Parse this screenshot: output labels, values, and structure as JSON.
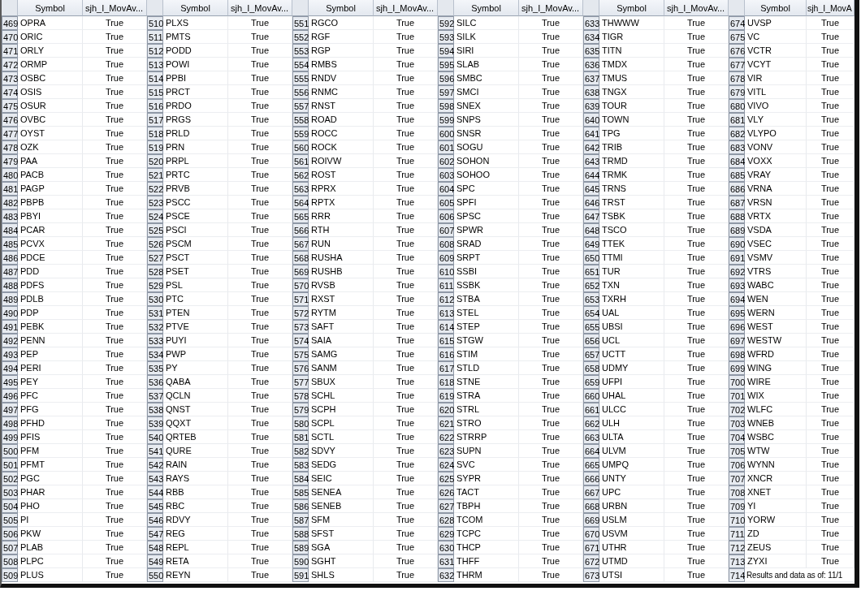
{
  "panels": [
    {
      "columns": [
        "Symbol",
        "sjh_I_MovAv..."
      ],
      "rows": [
        {
          "kind": "data",
          "n": "469",
          "symbol": "OPRA",
          "value": "True"
        },
        {
          "kind": "data",
          "n": "470",
          "symbol": "ORIC",
          "value": "True"
        },
        {
          "kind": "data",
          "n": "471",
          "symbol": "ORLY",
          "value": "True"
        },
        {
          "kind": "data",
          "n": "472",
          "symbol": "ORMP",
          "value": "True"
        },
        {
          "kind": "data",
          "n": "473",
          "symbol": "OSBC",
          "value": "True"
        },
        {
          "kind": "data",
          "n": "474",
          "symbol": "OSIS",
          "value": "True"
        },
        {
          "kind": "data",
          "n": "475",
          "symbol": "OSUR",
          "value": "True"
        },
        {
          "kind": "data",
          "n": "476",
          "symbol": "OVBC",
          "value": "True"
        },
        {
          "kind": "data",
          "n": "477",
          "symbol": "OYST",
          "value": "True"
        },
        {
          "kind": "data",
          "n": "478",
          "symbol": "OZK",
          "value": "True"
        },
        {
          "kind": "data",
          "n": "479",
          "symbol": "PAA",
          "value": "True"
        },
        {
          "kind": "data",
          "n": "480",
          "symbol": "PACB",
          "value": "True"
        },
        {
          "kind": "data",
          "n": "481",
          "symbol": "PAGP",
          "value": "True"
        },
        {
          "kind": "data",
          "n": "482",
          "symbol": "PBPB",
          "value": "True"
        },
        {
          "kind": "data",
          "n": "483",
          "symbol": "PBYI",
          "value": "True"
        },
        {
          "kind": "data",
          "n": "484",
          "symbol": "PCAR",
          "value": "True"
        },
        {
          "kind": "data",
          "n": "485",
          "symbol": "PCVX",
          "value": "True"
        },
        {
          "kind": "data",
          "n": "486",
          "symbol": "PDCE",
          "value": "True"
        },
        {
          "kind": "data",
          "n": "487",
          "symbol": "PDD",
          "value": "True"
        },
        {
          "kind": "data",
          "n": "488",
          "symbol": "PDFS",
          "value": "True"
        },
        {
          "kind": "data",
          "n": "489",
          "symbol": "PDLB",
          "value": "True"
        },
        {
          "kind": "data",
          "n": "490",
          "symbol": "PDP",
          "value": "True"
        },
        {
          "kind": "data",
          "n": "491",
          "symbol": "PEBK",
          "value": "True"
        },
        {
          "kind": "data",
          "n": "492",
          "symbol": "PENN",
          "value": "True"
        },
        {
          "kind": "data",
          "n": "493",
          "symbol": "PEP",
          "value": "True"
        },
        {
          "kind": "data",
          "n": "494",
          "symbol": "PERI",
          "value": "True"
        },
        {
          "kind": "data",
          "n": "495",
          "symbol": "PEY",
          "value": "True"
        },
        {
          "kind": "data",
          "n": "496",
          "symbol": "PFC",
          "value": "True"
        },
        {
          "kind": "data",
          "n": "497",
          "symbol": "PFG",
          "value": "True"
        },
        {
          "kind": "data",
          "n": "498",
          "symbol": "PFHD",
          "value": "True"
        },
        {
          "kind": "data",
          "n": "499",
          "symbol": "PFIS",
          "value": "True"
        },
        {
          "kind": "data",
          "n": "500",
          "symbol": "PFM",
          "value": "True"
        },
        {
          "kind": "data",
          "n": "501",
          "symbol": "PFMT",
          "value": "True"
        },
        {
          "kind": "data",
          "n": "502",
          "symbol": "PGC",
          "value": "True"
        },
        {
          "kind": "data",
          "n": "503",
          "symbol": "PHAR",
          "value": "True"
        },
        {
          "kind": "data",
          "n": "504",
          "symbol": "PHO",
          "value": "True"
        },
        {
          "kind": "data",
          "n": "505",
          "symbol": "PI",
          "value": "True"
        },
        {
          "kind": "data",
          "n": "506",
          "symbol": "PKW",
          "value": "True"
        },
        {
          "kind": "data",
          "n": "507",
          "symbol": "PLAB",
          "value": "True"
        },
        {
          "kind": "data",
          "n": "508",
          "symbol": "PLPC",
          "value": "True"
        },
        {
          "kind": "data",
          "n": "509",
          "symbol": "PLUS",
          "value": "True"
        }
      ]
    },
    {
      "columns": [
        "Symbol",
        "sjh_I_MovAv..."
      ],
      "rows": [
        {
          "kind": "data",
          "n": "510",
          "symbol": "PLXS",
          "value": "True"
        },
        {
          "kind": "data",
          "n": "511",
          "symbol": "PMTS",
          "value": "True"
        },
        {
          "kind": "data",
          "n": "512",
          "symbol": "PODD",
          "value": "True"
        },
        {
          "kind": "data",
          "n": "513",
          "symbol": "POWI",
          "value": "True"
        },
        {
          "kind": "data",
          "n": "514",
          "symbol": "PPBI",
          "value": "True"
        },
        {
          "kind": "data",
          "n": "515",
          "symbol": "PRCT",
          "value": "True"
        },
        {
          "kind": "data",
          "n": "516",
          "symbol": "PRDO",
          "value": "True"
        },
        {
          "kind": "data",
          "n": "517",
          "symbol": "PRGS",
          "value": "True"
        },
        {
          "kind": "data",
          "n": "518",
          "symbol": "PRLD",
          "value": "True"
        },
        {
          "kind": "data",
          "n": "519",
          "symbol": "PRN",
          "value": "True"
        },
        {
          "kind": "data",
          "n": "520",
          "symbol": "PRPL",
          "value": "True"
        },
        {
          "kind": "data",
          "n": "521",
          "symbol": "PRTC",
          "value": "True"
        },
        {
          "kind": "data",
          "n": "522",
          "symbol": "PRVB",
          "value": "True"
        },
        {
          "kind": "data",
          "n": "523",
          "symbol": "PSCC",
          "value": "True"
        },
        {
          "kind": "data",
          "n": "524",
          "symbol": "PSCE",
          "value": "True"
        },
        {
          "kind": "data",
          "n": "525",
          "symbol": "PSCI",
          "value": "True"
        },
        {
          "kind": "data",
          "n": "526",
          "symbol": "PSCM",
          "value": "True"
        },
        {
          "kind": "data",
          "n": "527",
          "symbol": "PSCT",
          "value": "True"
        },
        {
          "kind": "data",
          "n": "528",
          "symbol": "PSET",
          "value": "True"
        },
        {
          "kind": "data",
          "n": "529",
          "symbol": "PSL",
          "value": "True"
        },
        {
          "kind": "data",
          "n": "530",
          "symbol": "PTC",
          "value": "True"
        },
        {
          "kind": "data",
          "n": "531",
          "symbol": "PTEN",
          "value": "True"
        },
        {
          "kind": "data",
          "n": "532",
          "symbol": "PTVE",
          "value": "True"
        },
        {
          "kind": "data",
          "n": "533",
          "symbol": "PUYI",
          "value": "True"
        },
        {
          "kind": "data",
          "n": "534",
          "symbol": "PWP",
          "value": "True"
        },
        {
          "kind": "data",
          "n": "535",
          "symbol": "PY",
          "value": "True"
        },
        {
          "kind": "data",
          "n": "536",
          "symbol": "QABA",
          "value": "True"
        },
        {
          "kind": "data",
          "n": "537",
          "symbol": "QCLN",
          "value": "True"
        },
        {
          "kind": "data",
          "n": "538",
          "symbol": "QNST",
          "value": "True"
        },
        {
          "kind": "data",
          "n": "539",
          "symbol": "QQXT",
          "value": "True"
        },
        {
          "kind": "data",
          "n": "540",
          "symbol": "QRTEB",
          "value": "True"
        },
        {
          "kind": "data",
          "n": "541",
          "symbol": "QURE",
          "value": "True"
        },
        {
          "kind": "data",
          "n": "542",
          "symbol": "RAIN",
          "value": "True"
        },
        {
          "kind": "data",
          "n": "543",
          "symbol": "RAYS",
          "value": "True"
        },
        {
          "kind": "data",
          "n": "544",
          "symbol": "RBB",
          "value": "True"
        },
        {
          "kind": "data",
          "n": "545",
          "symbol": "RBC",
          "value": "True"
        },
        {
          "kind": "data",
          "n": "546",
          "symbol": "RDVY",
          "value": "True"
        },
        {
          "kind": "data",
          "n": "547",
          "symbol": "REG",
          "value": "True"
        },
        {
          "kind": "data",
          "n": "548",
          "symbol": "REPL",
          "value": "True"
        },
        {
          "kind": "data",
          "n": "549",
          "symbol": "RETA",
          "value": "True"
        },
        {
          "kind": "data",
          "n": "550",
          "symbol": "REYN",
          "value": "True"
        }
      ]
    },
    {
      "columns": [
        "Symbol",
        "sjh_I_MovAv..."
      ],
      "rows": [
        {
          "kind": "data",
          "n": "551",
          "symbol": "RGCO",
          "value": "True"
        },
        {
          "kind": "data",
          "n": "552",
          "symbol": "RGF",
          "value": "True"
        },
        {
          "kind": "data",
          "n": "553",
          "symbol": "RGP",
          "value": "True"
        },
        {
          "kind": "data",
          "n": "554",
          "symbol": "RMBS",
          "value": "True"
        },
        {
          "kind": "data",
          "n": "555",
          "symbol": "RNDV",
          "value": "True"
        },
        {
          "kind": "data",
          "n": "556",
          "symbol": "RNMC",
          "value": "True"
        },
        {
          "kind": "data",
          "n": "557",
          "symbol": "RNST",
          "value": "True"
        },
        {
          "kind": "data",
          "n": "558",
          "symbol": "ROAD",
          "value": "True"
        },
        {
          "kind": "data",
          "n": "559",
          "symbol": "ROCC",
          "value": "True"
        },
        {
          "kind": "data",
          "n": "560",
          "symbol": "ROCK",
          "value": "True"
        },
        {
          "kind": "data",
          "n": "561",
          "symbol": "ROIVW",
          "value": "True"
        },
        {
          "kind": "data",
          "n": "562",
          "symbol": "ROST",
          "value": "True"
        },
        {
          "kind": "data",
          "n": "563",
          "symbol": "RPRX",
          "value": "True"
        },
        {
          "kind": "data",
          "n": "564",
          "symbol": "RPTX",
          "value": "True"
        },
        {
          "kind": "data",
          "n": "565",
          "symbol": "RRR",
          "value": "True"
        },
        {
          "kind": "data",
          "n": "566",
          "symbol": "RTH",
          "value": "True"
        },
        {
          "kind": "data",
          "n": "567",
          "symbol": "RUN",
          "value": "True"
        },
        {
          "kind": "data",
          "n": "568",
          "symbol": "RUSHA",
          "value": "True"
        },
        {
          "kind": "data",
          "n": "569",
          "symbol": "RUSHB",
          "value": "True"
        },
        {
          "kind": "data",
          "n": "570",
          "symbol": "RVSB",
          "value": "True"
        },
        {
          "kind": "data",
          "n": "571",
          "symbol": "RXST",
          "value": "True"
        },
        {
          "kind": "data",
          "n": "572",
          "symbol": "RYTM",
          "value": "True"
        },
        {
          "kind": "data",
          "n": "573",
          "symbol": "SAFT",
          "value": "True"
        },
        {
          "kind": "data",
          "n": "574",
          "symbol": "SAIA",
          "value": "True"
        },
        {
          "kind": "data",
          "n": "575",
          "symbol": "SAMG",
          "value": "True"
        },
        {
          "kind": "data",
          "n": "576",
          "symbol": "SANM",
          "value": "True"
        },
        {
          "kind": "data",
          "n": "577",
          "symbol": "SBUX",
          "value": "True"
        },
        {
          "kind": "data",
          "n": "578",
          "symbol": "SCHL",
          "value": "True"
        },
        {
          "kind": "data",
          "n": "579",
          "symbol": "SCPH",
          "value": "True"
        },
        {
          "kind": "data",
          "n": "580",
          "symbol": "SCPL",
          "value": "True"
        },
        {
          "kind": "data",
          "n": "581",
          "symbol": "SCTL",
          "value": "True"
        },
        {
          "kind": "data",
          "n": "582",
          "symbol": "SDVY",
          "value": "True"
        },
        {
          "kind": "data",
          "n": "583",
          "symbol": "SEDG",
          "value": "True"
        },
        {
          "kind": "data",
          "n": "584",
          "symbol": "SEIC",
          "value": "True"
        },
        {
          "kind": "data",
          "n": "585",
          "symbol": "SENEA",
          "value": "True"
        },
        {
          "kind": "data",
          "n": "586",
          "symbol": "SENEB",
          "value": "True"
        },
        {
          "kind": "data",
          "n": "587",
          "symbol": "SFM",
          "value": "True"
        },
        {
          "kind": "data",
          "n": "588",
          "symbol": "SFST",
          "value": "True"
        },
        {
          "kind": "data",
          "n": "589",
          "symbol": "SGA",
          "value": "True"
        },
        {
          "kind": "data",
          "n": "590",
          "symbol": "SGHT",
          "value": "True"
        },
        {
          "kind": "data",
          "n": "591",
          "symbol": "SHLS",
          "value": "True"
        }
      ]
    },
    {
      "columns": [
        "Symbol",
        "sjh_I_MovAv..."
      ],
      "rows": [
        {
          "kind": "data",
          "n": "592",
          "symbol": "SILC",
          "value": "True"
        },
        {
          "kind": "data",
          "n": "593",
          "symbol": "SILK",
          "value": "True"
        },
        {
          "kind": "data",
          "n": "594",
          "symbol": "SIRI",
          "value": "True"
        },
        {
          "kind": "data",
          "n": "595",
          "symbol": "SLAB",
          "value": "True"
        },
        {
          "kind": "data",
          "n": "596",
          "symbol": "SMBC",
          "value": "True"
        },
        {
          "kind": "data",
          "n": "597",
          "symbol": "SMCI",
          "value": "True"
        },
        {
          "kind": "data",
          "n": "598",
          "symbol": "SNEX",
          "value": "True"
        },
        {
          "kind": "data",
          "n": "599",
          "symbol": "SNPS",
          "value": "True"
        },
        {
          "kind": "data",
          "n": "600",
          "symbol": "SNSR",
          "value": "True"
        },
        {
          "kind": "data",
          "n": "601",
          "symbol": "SOGU",
          "value": "True"
        },
        {
          "kind": "data",
          "n": "602",
          "symbol": "SOHON",
          "value": "True"
        },
        {
          "kind": "data",
          "n": "603",
          "symbol": "SOHOO",
          "value": "True"
        },
        {
          "kind": "data",
          "n": "604",
          "symbol": "SPC",
          "value": "True"
        },
        {
          "kind": "data",
          "n": "605",
          "symbol": "SPFI",
          "value": "True"
        },
        {
          "kind": "data",
          "n": "606",
          "symbol": "SPSC",
          "value": "True"
        },
        {
          "kind": "data",
          "n": "607",
          "symbol": "SPWR",
          "value": "True"
        },
        {
          "kind": "data",
          "n": "608",
          "symbol": "SRAD",
          "value": "True"
        },
        {
          "kind": "data",
          "n": "609",
          "symbol": "SRPT",
          "value": "True"
        },
        {
          "kind": "data",
          "n": "610",
          "symbol": "SSBI",
          "value": "True"
        },
        {
          "kind": "data",
          "n": "611",
          "symbol": "SSBK",
          "value": "True"
        },
        {
          "kind": "data",
          "n": "612",
          "symbol": "STBA",
          "value": "True"
        },
        {
          "kind": "data",
          "n": "613",
          "symbol": "STEL",
          "value": "True"
        },
        {
          "kind": "data",
          "n": "614",
          "symbol": "STEP",
          "value": "True"
        },
        {
          "kind": "data",
          "n": "615",
          "symbol": "STGW",
          "value": "True"
        },
        {
          "kind": "data",
          "n": "616",
          "symbol": "STIM",
          "value": "True"
        },
        {
          "kind": "data",
          "n": "617",
          "symbol": "STLD",
          "value": "True"
        },
        {
          "kind": "data",
          "n": "618",
          "symbol": "STNE",
          "value": "True"
        },
        {
          "kind": "data",
          "n": "619",
          "symbol": "STRA",
          "value": "True"
        },
        {
          "kind": "data",
          "n": "620",
          "symbol": "STRL",
          "value": "True"
        },
        {
          "kind": "data",
          "n": "621",
          "symbol": "STRO",
          "value": "True"
        },
        {
          "kind": "data",
          "n": "622",
          "symbol": "STRRP",
          "value": "True"
        },
        {
          "kind": "data",
          "n": "623",
          "symbol": "SUPN",
          "value": "True"
        },
        {
          "kind": "data",
          "n": "624",
          "symbol": "SVC",
          "value": "True"
        },
        {
          "kind": "data",
          "n": "625",
          "symbol": "SYPR",
          "value": "True"
        },
        {
          "kind": "data",
          "n": "626",
          "symbol": "TACT",
          "value": "True"
        },
        {
          "kind": "data",
          "n": "627",
          "symbol": "TBPH",
          "value": "True"
        },
        {
          "kind": "data",
          "n": "628",
          "symbol": "TCOM",
          "value": "True"
        },
        {
          "kind": "data",
          "n": "629",
          "symbol": "TCPC",
          "value": "True"
        },
        {
          "kind": "data",
          "n": "630",
          "symbol": "THCP",
          "value": "True"
        },
        {
          "kind": "data",
          "n": "631",
          "symbol": "THFF",
          "value": "True"
        },
        {
          "kind": "data",
          "n": "632",
          "symbol": "THRM",
          "value": "True"
        }
      ]
    },
    {
      "columns": [
        "Symbol",
        "sjh_I_MovAv..."
      ],
      "rows": [
        {
          "kind": "data",
          "n": "633",
          "symbol": "THWWW",
          "value": "True"
        },
        {
          "kind": "data",
          "n": "634",
          "symbol": "TIGR",
          "value": "True"
        },
        {
          "kind": "data",
          "n": "635",
          "symbol": "TITN",
          "value": "True"
        },
        {
          "kind": "data",
          "n": "636",
          "symbol": "TMDX",
          "value": "True"
        },
        {
          "kind": "data",
          "n": "637",
          "symbol": "TMUS",
          "value": "True"
        },
        {
          "kind": "data",
          "n": "638",
          "symbol": "TNGX",
          "value": "True"
        },
        {
          "kind": "data",
          "n": "639",
          "symbol": "TOUR",
          "value": "True"
        },
        {
          "kind": "data",
          "n": "640",
          "symbol": "TOWN",
          "value": "True"
        },
        {
          "kind": "data",
          "n": "641",
          "symbol": "TPG",
          "value": "True"
        },
        {
          "kind": "data",
          "n": "642",
          "symbol": "TRIB",
          "value": "True"
        },
        {
          "kind": "data",
          "n": "643",
          "symbol": "TRMD",
          "value": "True"
        },
        {
          "kind": "data",
          "n": "644",
          "symbol": "TRMK",
          "value": "True"
        },
        {
          "kind": "data",
          "n": "645",
          "symbol": "TRNS",
          "value": "True"
        },
        {
          "kind": "data",
          "n": "646",
          "symbol": "TRST",
          "value": "True"
        },
        {
          "kind": "data",
          "n": "647",
          "symbol": "TSBK",
          "value": "True"
        },
        {
          "kind": "data",
          "n": "648",
          "symbol": "TSCO",
          "value": "True"
        },
        {
          "kind": "data",
          "n": "649",
          "symbol": "TTEK",
          "value": "True"
        },
        {
          "kind": "data",
          "n": "650",
          "symbol": "TTMI",
          "value": "True"
        },
        {
          "kind": "data",
          "n": "651",
          "symbol": "TUR",
          "value": "True"
        },
        {
          "kind": "data",
          "n": "652",
          "symbol": "TXN",
          "value": "True"
        },
        {
          "kind": "data",
          "n": "653",
          "symbol": "TXRH",
          "value": "True"
        },
        {
          "kind": "data",
          "n": "654",
          "symbol": "UAL",
          "value": "True"
        },
        {
          "kind": "data",
          "n": "655",
          "symbol": "UBSI",
          "value": "True"
        },
        {
          "kind": "data",
          "n": "656",
          "symbol": "UCL",
          "value": "True"
        },
        {
          "kind": "data",
          "n": "657",
          "symbol": "UCTT",
          "value": "True"
        },
        {
          "kind": "data",
          "n": "658",
          "symbol": "UDMY",
          "value": "True"
        },
        {
          "kind": "data",
          "n": "659",
          "symbol": "UFPI",
          "value": "True"
        },
        {
          "kind": "data",
          "n": "660",
          "symbol": "UHAL",
          "value": "True"
        },
        {
          "kind": "data",
          "n": "661",
          "symbol": "ULCC",
          "value": "True"
        },
        {
          "kind": "data",
          "n": "662",
          "symbol": "ULH",
          "value": "True"
        },
        {
          "kind": "data",
          "n": "663",
          "symbol": "ULTA",
          "value": "True"
        },
        {
          "kind": "data",
          "n": "664",
          "symbol": "ULVM",
          "value": "True"
        },
        {
          "kind": "data",
          "n": "665",
          "symbol": "UMPQ",
          "value": "True"
        },
        {
          "kind": "data",
          "n": "666",
          "symbol": "UNTY",
          "value": "True"
        },
        {
          "kind": "data",
          "n": "667",
          "symbol": "UPC",
          "value": "True"
        },
        {
          "kind": "data",
          "n": "668",
          "symbol": "URBN",
          "value": "True"
        },
        {
          "kind": "data",
          "n": "669",
          "symbol": "USLM",
          "value": "True"
        },
        {
          "kind": "data",
          "n": "670",
          "symbol": "USVM",
          "value": "True"
        },
        {
          "kind": "data",
          "n": "671",
          "symbol": "UTHR",
          "value": "True"
        },
        {
          "kind": "data",
          "n": "672",
          "symbol": "UTMD",
          "value": "True"
        },
        {
          "kind": "data",
          "n": "673",
          "symbol": "UTSI",
          "value": "True"
        }
      ]
    },
    {
      "columns": [
        "Symbol",
        "sjh_I_MovA"
      ],
      "rows": [
        {
          "kind": "data",
          "n": "674",
          "symbol": "UVSP",
          "value": "True"
        },
        {
          "kind": "data",
          "n": "675",
          "symbol": "VC",
          "value": "True"
        },
        {
          "kind": "data",
          "n": "676",
          "symbol": "VCTR",
          "value": "True"
        },
        {
          "kind": "data",
          "n": "677",
          "symbol": "VCYT",
          "value": "True"
        },
        {
          "kind": "data",
          "n": "678",
          "symbol": "VIR",
          "value": "True"
        },
        {
          "kind": "data",
          "n": "679",
          "symbol": "VITL",
          "value": "True"
        },
        {
          "kind": "data",
          "n": "680",
          "symbol": "VIVO",
          "value": "True"
        },
        {
          "kind": "data",
          "n": "681",
          "symbol": "VLY",
          "value": "True"
        },
        {
          "kind": "data",
          "n": "682",
          "symbol": "VLYPO",
          "value": "True"
        },
        {
          "kind": "data",
          "n": "683",
          "symbol": "VONV",
          "value": "True"
        },
        {
          "kind": "data",
          "n": "684",
          "symbol": "VOXX",
          "value": "True"
        },
        {
          "kind": "data",
          "n": "685",
          "symbol": "VRAY",
          "value": "True"
        },
        {
          "kind": "data",
          "n": "686",
          "symbol": "VRNA",
          "value": "True"
        },
        {
          "kind": "data",
          "n": "687",
          "symbol": "VRSN",
          "value": "True"
        },
        {
          "kind": "data",
          "n": "688",
          "symbol": "VRTX",
          "value": "True"
        },
        {
          "kind": "data",
          "n": "689",
          "symbol": "VSDA",
          "value": "True"
        },
        {
          "kind": "data",
          "n": "690",
          "symbol": "VSEC",
          "value": "True"
        },
        {
          "kind": "data",
          "n": "691",
          "symbol": "VSMV",
          "value": "True"
        },
        {
          "kind": "data",
          "n": "692",
          "symbol": "VTRS",
          "value": "True"
        },
        {
          "kind": "data",
          "n": "693",
          "symbol": "WABC",
          "value": "True"
        },
        {
          "kind": "data",
          "n": "694",
          "symbol": "WEN",
          "value": "True"
        },
        {
          "kind": "data",
          "n": "695",
          "symbol": "WERN",
          "value": "True"
        },
        {
          "kind": "data",
          "n": "696",
          "symbol": "WEST",
          "value": "True"
        },
        {
          "kind": "data",
          "n": "697",
          "symbol": "WESTW",
          "value": "True"
        },
        {
          "kind": "data",
          "n": "698",
          "symbol": "WFRD",
          "value": "True"
        },
        {
          "kind": "data",
          "n": "699",
          "symbol": "WING",
          "value": "True"
        },
        {
          "kind": "data",
          "n": "700",
          "symbol": "WIRE",
          "value": "True"
        },
        {
          "kind": "data",
          "n": "701",
          "symbol": "WIX",
          "value": "True"
        },
        {
          "kind": "data",
          "n": "702",
          "symbol": "WLFC",
          "value": "True"
        },
        {
          "kind": "data",
          "n": "703",
          "symbol": "WNEB",
          "value": "True"
        },
        {
          "kind": "data",
          "n": "704",
          "symbol": "WSBC",
          "value": "True"
        },
        {
          "kind": "data",
          "n": "705",
          "symbol": "WTW",
          "value": "True"
        },
        {
          "kind": "data",
          "n": "706",
          "symbol": "WYNN",
          "value": "True"
        },
        {
          "kind": "data",
          "n": "707",
          "symbol": "XNCR",
          "value": "True"
        },
        {
          "kind": "data",
          "n": "708",
          "symbol": "XNET",
          "value": "True"
        },
        {
          "kind": "data",
          "n": "709",
          "symbol": "YI",
          "value": "True"
        },
        {
          "kind": "data",
          "n": "710",
          "symbol": "YORW",
          "value": "True"
        },
        {
          "kind": "data",
          "n": "711",
          "symbol": "ZD",
          "value": "True"
        },
        {
          "kind": "data",
          "n": "712",
          "symbol": "ZEUS",
          "value": "True"
        },
        {
          "kind": "data",
          "n": "713",
          "symbol": "ZYXI",
          "value": "True"
        },
        {
          "kind": "note",
          "n": "714",
          "text": "Results and data as of: 11/1"
        }
      ]
    }
  ]
}
